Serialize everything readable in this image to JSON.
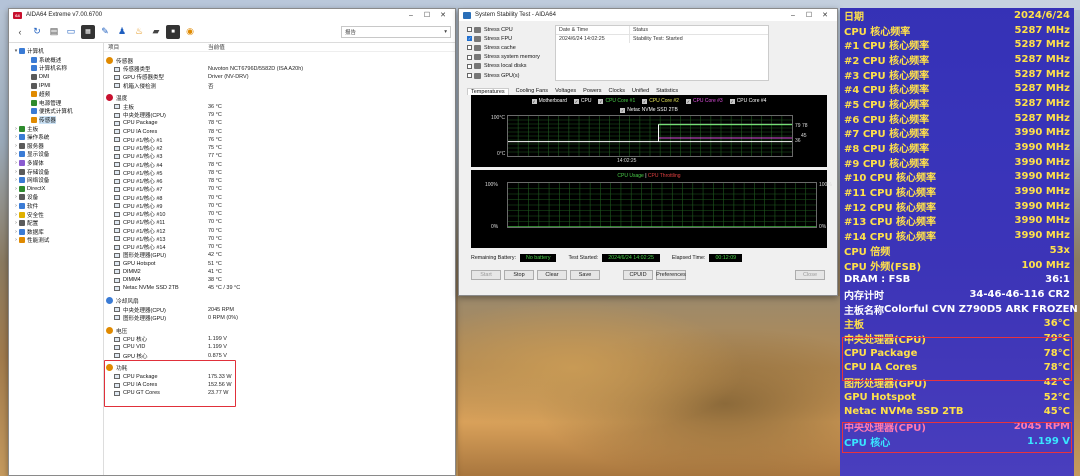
{
  "colors": {
    "osd_bg": "#3a31c0",
    "osd_white": "#ffffff",
    "osd_yellow": "#ffe14a",
    "osd_cyan": "#39e6ff",
    "osd_green": "#4be36a",
    "osd_pink": "#ff7ab0",
    "highlight_red": "#e0303a",
    "graph_green": "#49d049"
  },
  "aida": {
    "title": "AIDA64 Extreme v7.00.6700",
    "toolbar_icons": [
      "back-icon",
      "refresh-icon",
      "report-icon",
      "computer-icon",
      "chip-icon",
      "wrench-icon",
      "user-icon",
      "flame-icon",
      "disk-icon",
      "memory-icon",
      "aida-icon"
    ],
    "report_label": "报告",
    "tree": [
      {
        "label": "计算机",
        "level": 1,
        "expand": "▾",
        "icon_color": "#3a7bd5",
        "icon": "computer-icon"
      },
      {
        "label": "系统概述",
        "level": 2,
        "expand": "",
        "icon_color": "#3a7bd5",
        "icon": "summary-icon"
      },
      {
        "label": "计算机名称",
        "level": 2,
        "expand": "",
        "icon_color": "#3a7bd5",
        "icon": "computer-name-icon"
      },
      {
        "label": "DMI",
        "level": 2,
        "expand": "",
        "icon_color": "#5a5a5a",
        "icon": "dmi-icon"
      },
      {
        "label": "IPMI",
        "level": 2,
        "expand": "",
        "icon_color": "#5a5a5a",
        "icon": "ipmi-icon"
      },
      {
        "label": "超频",
        "level": 2,
        "expand": "",
        "icon_color": "#e08a00",
        "icon": "overclock-icon"
      },
      {
        "label": "电源管理",
        "level": 2,
        "expand": "",
        "icon_color": "#2e8b2e",
        "icon": "power-icon"
      },
      {
        "label": "便携式计算机",
        "level": 2,
        "expand": "",
        "icon_color": "#3a7bd5",
        "icon": "laptop-icon"
      },
      {
        "label": "传感器",
        "level": 2,
        "expand": "",
        "icon_color": "#e08a00",
        "icon": "sensor-icon",
        "selected": true
      },
      {
        "label": "主板",
        "level": 1,
        "expand": "›",
        "icon_color": "#2e8b2e",
        "icon": "motherboard-icon"
      },
      {
        "label": "操作系统",
        "level": 1,
        "expand": "›",
        "icon_color": "#3a7bd5",
        "icon": "os-icon"
      },
      {
        "label": "服务器",
        "level": 1,
        "expand": "›",
        "icon_color": "#5a5a5a",
        "icon": "server-icon"
      },
      {
        "label": "显示设备",
        "level": 1,
        "expand": "›",
        "icon_color": "#3a7bd5",
        "icon": "display-icon"
      },
      {
        "label": "多媒体",
        "level": 1,
        "expand": "›",
        "icon_color": "#8a5ad0",
        "icon": "multimedia-icon"
      },
      {
        "label": "存储设备",
        "level": 1,
        "expand": "›",
        "icon_color": "#5a5a5a",
        "icon": "storage-icon"
      },
      {
        "label": "网络设备",
        "level": 1,
        "expand": "›",
        "icon_color": "#3a7bd5",
        "icon": "network-icon"
      },
      {
        "label": "DirectX",
        "level": 1,
        "expand": "›",
        "icon_color": "#2e8b2e",
        "icon": "directx-icon"
      },
      {
        "label": "设备",
        "level": 1,
        "expand": "›",
        "icon_color": "#5a5a5a",
        "icon": "devices-icon"
      },
      {
        "label": "软件",
        "level": 1,
        "expand": "›",
        "icon_color": "#3a7bd5",
        "icon": "software-icon"
      },
      {
        "label": "安全性",
        "level": 1,
        "expand": "›",
        "icon_color": "#e0b000",
        "icon": "security-icon"
      },
      {
        "label": "配置",
        "level": 1,
        "expand": "›",
        "icon_color": "#5a5a5a",
        "icon": "config-icon"
      },
      {
        "label": "数据库",
        "level": 1,
        "expand": "›",
        "icon_color": "#3a7bd5",
        "icon": "database-icon"
      },
      {
        "label": "性能测试",
        "level": 1,
        "expand": "›",
        "icon_color": "#e08a00",
        "icon": "benchmark-icon"
      }
    ],
    "columns": {
      "item": "项目",
      "value": "当前值"
    },
    "sections": [
      {
        "title": "传感器",
        "icon": "sensor-icon",
        "icon_color": "#e08a00",
        "rows": [
          {
            "label": "传感器类型",
            "value": "Nuvoton NCT6796D/5582D  (ISA A20h)"
          },
          {
            "label": "GPU 传感器类型",
            "value": "Driver  (NV-DRV)"
          },
          {
            "label": "机箱入侵检测",
            "value": "否"
          }
        ]
      },
      {
        "title": "温度",
        "icon": "temperature-icon",
        "icon_color": "#c8102e",
        "rows": [
          {
            "label": "主板",
            "value": "36 °C"
          },
          {
            "label": "中央处理器(CPU)",
            "value": "79 °C"
          },
          {
            "label": "CPU Package",
            "value": "78 °C"
          },
          {
            "label": "CPU IA Cores",
            "value": "78 °C"
          },
          {
            "label": "CPU #1/核心 #1",
            "value": "76 °C"
          },
          {
            "label": "CPU #1/核心 #2",
            "value": "75 °C"
          },
          {
            "label": "CPU #1/核心 #3",
            "value": "77 °C"
          },
          {
            "label": "CPU #1/核心 #4",
            "value": "78 °C"
          },
          {
            "label": "CPU #1/核心 #5",
            "value": "78 °C"
          },
          {
            "label": "CPU #1/核心 #6",
            "value": "78 °C"
          },
          {
            "label": "CPU #1/核心 #7",
            "value": "70 °C"
          },
          {
            "label": "CPU #1/核心 #8",
            "value": "70 °C"
          },
          {
            "label": "CPU #1/核心 #9",
            "value": "70 °C"
          },
          {
            "label": "CPU #1/核心 #10",
            "value": "70 °C"
          },
          {
            "label": "CPU #1/核心 #11",
            "value": "70 °C"
          },
          {
            "label": "CPU #1/核心 #12",
            "value": "70 °C"
          },
          {
            "label": "CPU #1/核心 #13",
            "value": "70 °C"
          },
          {
            "label": "CPU #1/核心 #14",
            "value": "70 °C"
          },
          {
            "label": "图形处理器(GPU)",
            "value": "42 °C"
          },
          {
            "label": "GPU Hotspot",
            "value": "51 °C"
          },
          {
            "label": "DIMM2",
            "value": "41 °C"
          },
          {
            "label": "DIMM4",
            "value": "38 °C"
          },
          {
            "label": "Netac NVMe SSD 2TB",
            "value": "45 °C / 39 °C"
          }
        ]
      },
      {
        "title": "冷却风扇",
        "icon": "fan-icon",
        "icon_color": "#3a7bd5",
        "rows": [
          {
            "label": "中央处理器(CPU)",
            "value": "2045 RPM"
          },
          {
            "label": "图形处理器(GPU)",
            "value": "0 RPM  (0%)"
          }
        ]
      },
      {
        "title": "电压",
        "icon": "voltage-icon",
        "icon_color": "#e08a00",
        "rows": [
          {
            "label": "CPU 核心",
            "value": "1.199 V"
          },
          {
            "label": "CPU VID",
            "value": "1.199 V"
          },
          {
            "label": "GPU 核心",
            "value": "0.875 V"
          }
        ]
      },
      {
        "title": "功耗",
        "icon": "power-consumption-icon",
        "icon_color": "#e08a00",
        "rows": [
          {
            "label": "CPU Package",
            "value": "175.33 W"
          },
          {
            "label": "CPU IA Cores",
            "value": "152.56 W"
          },
          {
            "label": "CPU GT Cores",
            "value": "23.77 W"
          }
        ]
      }
    ]
  },
  "sst": {
    "title": "System Stability Test - AIDA64",
    "stress": [
      {
        "label": "Stress CPU",
        "checked": false
      },
      {
        "label": "Stress FPU",
        "checked": true
      },
      {
        "label": "Stress cache",
        "checked": false
      },
      {
        "label": "Stress system memory",
        "checked": false
      },
      {
        "label": "Stress local disks",
        "checked": false
      },
      {
        "label": "Stress GPU(s)",
        "checked": false
      }
    ],
    "table_headers": {
      "date": "Date & Time",
      "status": "Status"
    },
    "table_rows": [
      {
        "date": "2024/6/24 14:02:25",
        "status": "Stability Test: Started"
      }
    ],
    "tabs": [
      "Temperatures",
      "Cooling Fans",
      "Voltages",
      "Powers",
      "Clocks",
      "Unified",
      "Statistics"
    ],
    "active_tab": "Temperatures",
    "temp_legend": [
      {
        "label": "Motherboard",
        "color": "#ffffff"
      },
      {
        "label": "CPU",
        "color": "#ffffff"
      },
      {
        "label": "CPU Core #1",
        "color": "#49d049"
      },
      {
        "label": "CPU Core #2",
        "color": "#e8e85a"
      },
      {
        "label": "CPU Core #3",
        "color": "#e050e0"
      },
      {
        "label": "CPU Core #4",
        "color": "#ffffff"
      }
    ],
    "temp_legend2": "Netac NVMe SSD 2TB",
    "temp_y_top": "100°C",
    "temp_y_bottom": "0°C",
    "temp_x_time": "14:02:25",
    "temp_right_labels": [
      "79",
      "78",
      "45",
      "36"
    ],
    "usage_title": "CPU Usage",
    "usage_sep": "|",
    "usage_throttle": "CPU Throttling",
    "usage_y_top": "100%",
    "usage_y_bottom": "0%",
    "usage_right_top": "100%",
    "usage_right_bottom": "0%",
    "remaining_battery_label": "Remaining Battery:",
    "remaining_battery_value": "No battery",
    "test_started_label": "Test Started:",
    "test_started_value": "2024/6/24 14:02:25",
    "elapsed_label": "Elapsed Time:",
    "elapsed_value": "00:12:09",
    "buttons": [
      {
        "label": "Start",
        "dim": true
      },
      {
        "label": "Stop",
        "dim": false
      },
      {
        "label": "Clear",
        "dim": false
      },
      {
        "label": "Save",
        "dim": false
      },
      {
        "label": "CPUID",
        "dim": false
      },
      {
        "label": "Preferences",
        "dim": false
      },
      {
        "label": "Close",
        "dim": true
      }
    ]
  },
  "osd": {
    "rows": [
      {
        "k": "日期",
        "v": "2024/6/24",
        "color": "#ffe14a"
      },
      {
        "k": "CPU 核心频率",
        "v": "5287 MHz",
        "color": "#ffe14a"
      },
      {
        "k": "#1 CPU 核心频率",
        "v": "5287 MHz",
        "color": "#ffe14a"
      },
      {
        "k": "#2 CPU 核心频率",
        "v": "5287 MHz",
        "color": "#ffe14a"
      },
      {
        "k": "#3 CPU 核心频率",
        "v": "5287 MHz",
        "color": "#ffe14a"
      },
      {
        "k": "#4 CPU 核心频率",
        "v": "5287 MHz",
        "color": "#ffe14a"
      },
      {
        "k": "#5 CPU 核心频率",
        "v": "5287 MHz",
        "color": "#ffe14a"
      },
      {
        "k": "#6 CPU 核心频率",
        "v": "5287 MHz",
        "color": "#ffe14a"
      },
      {
        "k": "#7 CPU 核心频率",
        "v": "3990 MHz",
        "color": "#ffe14a"
      },
      {
        "k": "#8 CPU 核心频率",
        "v": "3990 MHz",
        "color": "#ffe14a"
      },
      {
        "k": "#9 CPU 核心频率",
        "v": "3990 MHz",
        "color": "#ffe14a"
      },
      {
        "k": "#10 CPU 核心频率",
        "v": "3990 MHz",
        "color": "#ffe14a"
      },
      {
        "k": "#11 CPU 核心频率",
        "v": "3990 MHz",
        "color": "#ffe14a"
      },
      {
        "k": "#12 CPU 核心频率",
        "v": "3990 MHz",
        "color": "#ffe14a"
      },
      {
        "k": "#13 CPU 核心频率",
        "v": "3990 MHz",
        "color": "#ffe14a"
      },
      {
        "k": "#14 CPU 核心频率",
        "v": "3990 MHz",
        "color": "#ffe14a"
      },
      {
        "k": "CPU 倍频",
        "v": "53x",
        "color": "#ffe14a"
      },
      {
        "k": "CPU 外频(FSB)",
        "v": "100 MHz",
        "color": "#ffe14a"
      },
      {
        "k": "DRAM : FSB",
        "v": "36:1",
        "color": "#ffffff"
      },
      {
        "k": "内存计时",
        "v": "34-46-46-116 CR2",
        "color": "#ffffff"
      },
      {
        "k": "主板名称",
        "v": "Colorful CVN Z790D5 ARK FROZEN",
        "color": "#ffffff"
      },
      {
        "k": "主板",
        "v": "36°C",
        "color": "#ffe14a"
      },
      {
        "k": "中央处理器(CPU)",
        "v": "79°C",
        "color": "#ffe14a"
      },
      {
        "k": "CPU Package",
        "v": "78°C",
        "color": "#ffe14a"
      },
      {
        "k": "CPU IA Cores",
        "v": "78°C",
        "color": "#ffe14a"
      },
      {
        "k": "图形处理器(GPU)",
        "v": "42°C",
        "color": "#ffe14a"
      },
      {
        "k": "GPU Hotspot",
        "v": "52°C",
        "color": "#ffe14a"
      },
      {
        "k": "Netac NVMe SSD 2TB",
        "v": "45°C",
        "color": "#ffe14a"
      },
      {
        "k": "中央处理器(CPU)",
        "v": "2045 RPM",
        "color": "#ff7ab0"
      },
      {
        "k": "CPU 核心",
        "v": "1.199 V",
        "color": "#39e6ff"
      }
    ]
  }
}
